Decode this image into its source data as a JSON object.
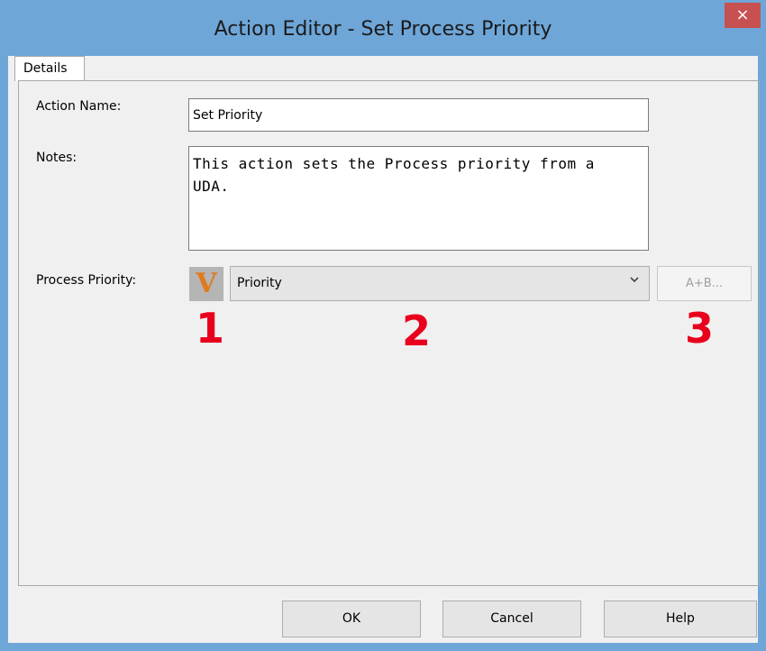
{
  "window": {
    "title": "Action Editor - Set Process Priority",
    "close_glyph": "×"
  },
  "tabs": [
    {
      "label": "Details",
      "selected": true
    }
  ],
  "form": {
    "action_name_label": "Action Name:",
    "action_name_value": "Set Priority",
    "notes_label": "Notes:",
    "notes_value": "This action sets the Process priority from a\nUDA.",
    "priority_label": "Process Priority:",
    "variable_button_glyph": "V",
    "priority_selected": "Priority",
    "expression_button_label": "A+B..."
  },
  "callouts": [
    "1",
    "2",
    "3"
  ],
  "buttons": {
    "ok": "OK",
    "cancel": "Cancel",
    "help": "Help"
  },
  "colors": {
    "titlebar": "#6ea6d8",
    "close": "#c75050",
    "callout": "#e8001c",
    "variable_icon": "#e07a1e"
  }
}
